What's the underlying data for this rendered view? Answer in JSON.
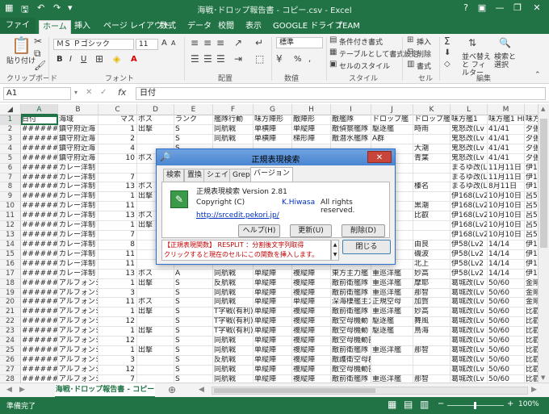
{
  "window": {
    "title": "海戦･ドロップ報告書 - コピー.csv - Excel",
    "minimize": "—",
    "restore": "❐",
    "close": "✕",
    "help": "?",
    "ribbon_opts": "▣"
  },
  "tabs": [
    "ファイル",
    "ホーム",
    "挿入",
    "ページ レイアウト",
    "数式",
    "データ",
    "校閲",
    "表示",
    "GOOGLE ドライブ",
    "TEAM"
  ],
  "ribbon": {
    "paste": "貼り付け",
    "clipboard": "クリップボード",
    "font_name": "ＭＳ Ｐゴシック",
    "font_size": "11",
    "bold": "B",
    "italic": "I",
    "underline": "U",
    "font_color_a": "A",
    "grow": "A",
    "shrink": "A",
    "font": "フォント",
    "align": "配置",
    "number_format": "標準",
    "percent": "%",
    "comma": ",",
    "number": "数値",
    "cond_format": "条件付き書式",
    "table_format": "テーブルとして書式設定",
    "cell_style": "セルのスタイル",
    "style": "スタイル",
    "insert": "挿入",
    "delete": "削除",
    "format": "書式",
    "cells": "セル",
    "sum": "Σ",
    "sort": "並べ替えと フィルター",
    "find": "検索と 選択",
    "edit": "編集"
  },
  "formula": {
    "namebox": "A1",
    "fx": "fx",
    "value": "日付",
    "cancel": "✕",
    "confirm": "✓"
  },
  "columns": [
    "A",
    "B",
    "C",
    "D",
    "E",
    "F",
    "G",
    "H",
    "I",
    "J",
    "K",
    "L",
    "M",
    "N"
  ],
  "rows": [
    [
      "日付",
      "海域",
      "マス",
      "ボス",
      "ランク",
      "艦隊行動",
      "味方陣形",
      "敵陣形",
      "敵艦隊",
      "ドロップ艦",
      "ドロップ艦",
      "味方艦1",
      "味方艦1 HP",
      "味方"
    ],
    [
      "########",
      "鎮守府近海",
      "1",
      "出撃",
      "S",
      "同航戦",
      "単横陣",
      "単縦陣",
      "敵偵察艦隊",
      "駆逐艦",
      "時雨",
      "鬼怒改(Lv",
      "41/41",
      "夕張"
    ],
    [
      "########",
      "鎮守府近海",
      "2",
      "",
      "S",
      "同航戦",
      "単横陣",
      "梯形陣",
      "敵潜水艦隊",
      "A群",
      "",
      "鬼怒改(Lv",
      "41/41",
      "夕張"
    ],
    [
      "########",
      "鎮守府近海",
      "4",
      "",
      "S",
      "",
      "",
      "",
      "",
      "",
      "大潮",
      "鬼怒改(Lv",
      "41/41",
      "夕張"
    ],
    [
      "########",
      "鎮守府近海",
      "10",
      "ボス",
      "S",
      "",
      "",
      "",
      "",
      "",
      "青葉",
      "鬼怒改(Lv",
      "41/41",
      "夕張"
    ],
    [
      "########",
      "カレー洋制",
      "",
      "",
      "",
      "",
      "",
      "",
      "",
      "",
      "",
      "まるゆ改(L",
      "11月11日",
      "伊1"
    ],
    [
      "########",
      "カレー洋制",
      "7",
      "",
      "",
      "",
      "",
      "",
      "",
      "",
      "",
      "まるゆ改(L",
      "11月11日",
      "伊1"
    ],
    [
      "########",
      "カレー洋制",
      "13",
      "ボス",
      "",
      "",
      "",
      "",
      "",
      "",
      "榛名",
      "まるゆ改(L",
      "8月11日",
      "伊1"
    ],
    [
      "########",
      "カレー洋制",
      "1",
      "出撃",
      "",
      "",
      "",
      "",
      "",
      "",
      "",
      "伊168(Lv2",
      "10月10日",
      "呂5"
    ],
    [
      "########",
      "カレー洋制",
      "11",
      "",
      "",
      "",
      "",
      "",
      "",
      "",
      "黒潮",
      "伊168(Lv2",
      "10月10日",
      "呂5"
    ],
    [
      "########",
      "カレー洋制",
      "13",
      "ボス",
      "",
      "",
      "",
      "",
      "",
      "",
      "比叡",
      "伊168(Lv2",
      "10月10日",
      "呂5"
    ],
    [
      "########",
      "カレー洋制",
      "1",
      "出撃",
      "",
      "",
      "",
      "",
      "",
      "",
      "",
      "伊168(Lv2",
      "10月10日",
      "呂5"
    ],
    [
      "########",
      "カレー洋制",
      "7",
      "",
      "",
      "",
      "",
      "",
      "",
      "",
      "",
      "伊168(Lv2",
      "10月10日",
      "呂5"
    ],
    [
      "########",
      "カレー洋制",
      "8",
      "",
      "",
      "",
      "",
      "",
      "",
      "",
      "由良",
      "伊58(Lv2",
      "14/14",
      "伊1"
    ],
    [
      "########",
      "カレー洋制",
      "11",
      "",
      "",
      "",
      "",
      "",
      "",
      "",
      "磯波",
      "伊58(Lv2",
      "14/14",
      "伊1"
    ],
    [
      "########",
      "カレー洋制",
      "11",
      "",
      "",
      "",
      "",
      "",
      "",
      "",
      "北上",
      "伊58(Lv2",
      "14/14",
      "伊1"
    ],
    [
      "########",
      "カレー洋制",
      "13",
      "ボス",
      "A",
      "同航戦",
      "単縦陣",
      "複縦陣",
      "東方主力艦",
      "重巡洋艦",
      "妙高",
      "伊58(Lv2",
      "14/14",
      "伊1"
    ],
    [
      "########",
      "アルフォンシ",
      "1",
      "出撃",
      "S",
      "反航戦",
      "単縦陣",
      "複縦陣",
      "敵前衛艦隊",
      "重巡洋艦",
      "摩耶",
      "葛城改(Lv",
      "50/60",
      "金剛"
    ],
    [
      "########",
      "アルフォンシ",
      "3",
      "",
      "S",
      "同航戦",
      "単縦陣",
      "複縦陣",
      "敵前衛艦隊",
      "重巡洋艦",
      "那智",
      "葛城改(Lv",
      "50/60",
      "金剛"
    ],
    [
      "########",
      "アルフォンシ",
      "11",
      "ボス",
      "S",
      "同航戦",
      "単縦陣",
      "単縦陣",
      "深海棲艦主力",
      "正規空母",
      "加賀",
      "葛城改(Lv",
      "50/60",
      "金剛"
    ],
    [
      "########",
      "アルフォンシ",
      "1",
      "出撃",
      "S",
      "T字戦(有利)",
      "単縦陣",
      "複縦陣",
      "敵前衛艦隊",
      "重巡洋艦",
      "妙高",
      "葛城改(Lv",
      "50/60",
      "比叡"
    ],
    [
      "########",
      "アルフォンシ",
      "12",
      "",
      "S",
      "T字戦(有利)",
      "単縦陣",
      "複縦陣",
      "敵空母機動",
      "駆逐艦",
      "舞風",
      "葛城改(Lv",
      "50/60",
      "比叡"
    ],
    [
      "########",
      "アルフォンシ",
      "1",
      "出撃",
      "S",
      "T字戦(有利)",
      "単縦陣",
      "複縦陣",
      "敵空母機動",
      "駆逐艦",
      "鳥海",
      "葛城改(Lv",
      "50/60",
      "比叡"
    ],
    [
      "########",
      "アルフォンシ",
      "12",
      "",
      "S",
      "同航戦",
      "単縦陣",
      "複縦陣",
      "敵空母機動部隊",
      "",
      "",
      "葛城改(Lv",
      "50/60",
      "比叡"
    ],
    [
      "########",
      "アルフォンシ",
      "1",
      "出撃",
      "S",
      "同航戦",
      "単縦陣",
      "複縦陣",
      "敵前衛艦隊",
      "重巡洋艦",
      "那智",
      "葛城改(Lv",
      "50/60",
      "比叡"
    ],
    [
      "########",
      "アルフォンシ",
      "3",
      "",
      "S",
      "反航戦",
      "単縦陣",
      "複縦陣",
      "敵護衛空母群",
      "",
      "",
      "葛城改(Lv",
      "50/60",
      "比叡"
    ],
    [
      "########",
      "アルフォンシ",
      "12",
      "",
      "S",
      "同航戦",
      "単縦陣",
      "複縦陣",
      "敵空母機動部隊",
      "",
      "",
      "葛城改(Lv",
      "50/60",
      "比叡"
    ],
    [
      "########",
      "アルフォンシ",
      "7",
      "",
      "S",
      "同航戦",
      "単縦陣",
      "複縦陣",
      "敵前衛艦隊",
      "重巡洋艦",
      "那智",
      "葛城改(Lv",
      "50/60",
      "比叡"
    ]
  ],
  "sheet": {
    "name": "海戦･ドロップ報告書 - コピー",
    "add": "⊕",
    "prev": "◀",
    "next": "▶"
  },
  "status": {
    "left": "準備完了",
    "zoom": "100%",
    "minus": "−",
    "plus": "+"
  },
  "dialog": {
    "title": "正規表現検索",
    "close": "✕",
    "tabs": [
      "検索",
      "置換",
      "シェイプ",
      "Grep",
      "バージョン"
    ],
    "product": "正規表現検索 Version 2.81",
    "copyright": "Copyright (C)",
    "author": "K.Hiwasa",
    "rights": "All rights reserved.",
    "url": "http://srcedit.pekori.jp/",
    "help_btn": "ヘルプ(H)",
    "update_btn": "更新(U)",
    "delete_btn": "削除(D)",
    "close_btn": "閉じる",
    "status_line1": "【正規表現関数】 RESPLIT ：分割後文字列取得",
    "status_line2": "クリックすると現在のセルにこの関数を挿入します。"
  }
}
